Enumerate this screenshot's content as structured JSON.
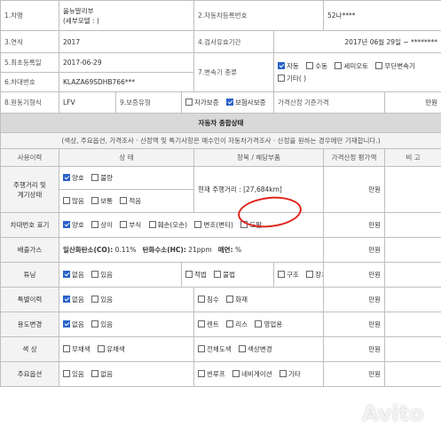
{
  "info": {
    "l1": "1.차명",
    "v1": "올뉴말리부\n(세부모델 : )",
    "l2": "2.자동차등록번호",
    "v2": "52나****",
    "l3": "3.연식",
    "v3": "2017",
    "l4": "4.검사유효기간",
    "v4": "2017년 06월 29일 ~ ********",
    "l5": "5.최초등록일",
    "v5": "2017-06-29",
    "l6": "6.차대번호",
    "v6": "KLAZA69SDHB766***",
    "l7": "7.변속기 종류",
    "trans_opts": [
      "자동",
      "수동",
      "세미오토",
      "무단변속기",
      "기타( )"
    ],
    "l8": "8.원동기형식",
    "v8": "LFV",
    "l9": "9.보증유형",
    "warranty_opts": [
      "자가보증",
      "보험사보증"
    ],
    "price_base_label": "가격산정 기준가격",
    "price_base_value": "만원"
  },
  "section": {
    "title": "자동차 종합상태",
    "subtitle": "(색상, 주요옵션, 가격조사 · 산정액 및 특기사항은 매수인이 자동차가격조사 · 산정을 원하는 경우에만 기재합니다.)"
  },
  "headers": {
    "h1": "사용이력",
    "h2": "상 태",
    "h3": "항목 / 해당부품",
    "h4": "가격산정 평가액",
    "h5": "비 고"
  },
  "rows": {
    "mileage_label": "주행거리 및\n계기상태",
    "mileage_opt1": [
      "양호",
      "불량"
    ],
    "mileage_opt2": [
      "많음",
      "보통",
      "적음"
    ],
    "mileage_text": "현재 주행거리 : [27,684km]",
    "manwon": "만원",
    "vin_label": "차대번호 표기",
    "vin_opts": [
      "양호",
      "상이",
      "부식",
      "훼손(오손)",
      "변조(변타)",
      "도말"
    ],
    "emission_label": "배출가스",
    "co_label": "일산화탄소(CO):",
    "co_value": "0.11%",
    "hc_label": "탄화수소(HC):",
    "hc_value": "21ppm",
    "smoke_label": "매연:",
    "smoke_value": "%",
    "tuning_label": "튜닝",
    "tuning_opts": [
      "없음",
      "있음"
    ],
    "tuning_opts2": [
      "적법",
      "불법"
    ],
    "tuning_opts3": [
      "구조",
      "장치"
    ],
    "special_label": "특별이력",
    "special_opts": [
      "없음",
      "있음"
    ],
    "special_opts2": [
      "침수",
      "화재"
    ],
    "usage_label": "용도변경",
    "usage_opts": [
      "없음",
      "있음"
    ],
    "usage_opts2": [
      "렌트",
      "리스",
      "영업용"
    ],
    "color_label": "색 상",
    "color_opts": [
      "무채색",
      "유채색"
    ],
    "color_opts2": [
      "전체도색",
      "색상변경"
    ],
    "options_label": "주요옵션",
    "options_opts": [
      "있음",
      "없음"
    ],
    "options_opts2": [
      "썬루프",
      "네비게이션",
      "기타"
    ]
  },
  "watermark": "Avito"
}
